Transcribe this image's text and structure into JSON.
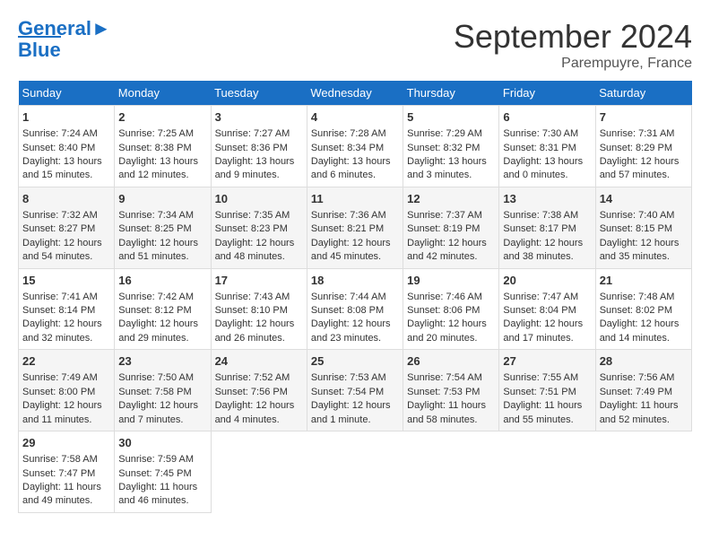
{
  "header": {
    "logo_line1": "General",
    "logo_line2": "Blue",
    "month": "September 2024",
    "location": "Parempuyre, France"
  },
  "days_of_week": [
    "Sunday",
    "Monday",
    "Tuesday",
    "Wednesday",
    "Thursday",
    "Friday",
    "Saturday"
  ],
  "weeks": [
    [
      {
        "day": 1,
        "lines": [
          "Sunrise: 7:24 AM",
          "Sunset: 8:40 PM",
          "Daylight: 13 hours",
          "and 15 minutes."
        ]
      },
      {
        "day": 2,
        "lines": [
          "Sunrise: 7:25 AM",
          "Sunset: 8:38 PM",
          "Daylight: 13 hours",
          "and 12 minutes."
        ]
      },
      {
        "day": 3,
        "lines": [
          "Sunrise: 7:27 AM",
          "Sunset: 8:36 PM",
          "Daylight: 13 hours",
          "and 9 minutes."
        ]
      },
      {
        "day": 4,
        "lines": [
          "Sunrise: 7:28 AM",
          "Sunset: 8:34 PM",
          "Daylight: 13 hours",
          "and 6 minutes."
        ]
      },
      {
        "day": 5,
        "lines": [
          "Sunrise: 7:29 AM",
          "Sunset: 8:32 PM",
          "Daylight: 13 hours",
          "and 3 minutes."
        ]
      },
      {
        "day": 6,
        "lines": [
          "Sunrise: 7:30 AM",
          "Sunset: 8:31 PM",
          "Daylight: 13 hours",
          "and 0 minutes."
        ]
      },
      {
        "day": 7,
        "lines": [
          "Sunrise: 7:31 AM",
          "Sunset: 8:29 PM",
          "Daylight: 12 hours",
          "and 57 minutes."
        ]
      }
    ],
    [
      {
        "day": 8,
        "lines": [
          "Sunrise: 7:32 AM",
          "Sunset: 8:27 PM",
          "Daylight: 12 hours",
          "and 54 minutes."
        ]
      },
      {
        "day": 9,
        "lines": [
          "Sunrise: 7:34 AM",
          "Sunset: 8:25 PM",
          "Daylight: 12 hours",
          "and 51 minutes."
        ]
      },
      {
        "day": 10,
        "lines": [
          "Sunrise: 7:35 AM",
          "Sunset: 8:23 PM",
          "Daylight: 12 hours",
          "and 48 minutes."
        ]
      },
      {
        "day": 11,
        "lines": [
          "Sunrise: 7:36 AM",
          "Sunset: 8:21 PM",
          "Daylight: 12 hours",
          "and 45 minutes."
        ]
      },
      {
        "day": 12,
        "lines": [
          "Sunrise: 7:37 AM",
          "Sunset: 8:19 PM",
          "Daylight: 12 hours",
          "and 42 minutes."
        ]
      },
      {
        "day": 13,
        "lines": [
          "Sunrise: 7:38 AM",
          "Sunset: 8:17 PM",
          "Daylight: 12 hours",
          "and 38 minutes."
        ]
      },
      {
        "day": 14,
        "lines": [
          "Sunrise: 7:40 AM",
          "Sunset: 8:15 PM",
          "Daylight: 12 hours",
          "and 35 minutes."
        ]
      }
    ],
    [
      {
        "day": 15,
        "lines": [
          "Sunrise: 7:41 AM",
          "Sunset: 8:14 PM",
          "Daylight: 12 hours",
          "and 32 minutes."
        ]
      },
      {
        "day": 16,
        "lines": [
          "Sunrise: 7:42 AM",
          "Sunset: 8:12 PM",
          "Daylight: 12 hours",
          "and 29 minutes."
        ]
      },
      {
        "day": 17,
        "lines": [
          "Sunrise: 7:43 AM",
          "Sunset: 8:10 PM",
          "Daylight: 12 hours",
          "and 26 minutes."
        ]
      },
      {
        "day": 18,
        "lines": [
          "Sunrise: 7:44 AM",
          "Sunset: 8:08 PM",
          "Daylight: 12 hours",
          "and 23 minutes."
        ]
      },
      {
        "day": 19,
        "lines": [
          "Sunrise: 7:46 AM",
          "Sunset: 8:06 PM",
          "Daylight: 12 hours",
          "and 20 minutes."
        ]
      },
      {
        "day": 20,
        "lines": [
          "Sunrise: 7:47 AM",
          "Sunset: 8:04 PM",
          "Daylight: 12 hours",
          "and 17 minutes."
        ]
      },
      {
        "day": 21,
        "lines": [
          "Sunrise: 7:48 AM",
          "Sunset: 8:02 PM",
          "Daylight: 12 hours",
          "and 14 minutes."
        ]
      }
    ],
    [
      {
        "day": 22,
        "lines": [
          "Sunrise: 7:49 AM",
          "Sunset: 8:00 PM",
          "Daylight: 12 hours",
          "and 11 minutes."
        ]
      },
      {
        "day": 23,
        "lines": [
          "Sunrise: 7:50 AM",
          "Sunset: 7:58 PM",
          "Daylight: 12 hours",
          "and 7 minutes."
        ]
      },
      {
        "day": 24,
        "lines": [
          "Sunrise: 7:52 AM",
          "Sunset: 7:56 PM",
          "Daylight: 12 hours",
          "and 4 minutes."
        ]
      },
      {
        "day": 25,
        "lines": [
          "Sunrise: 7:53 AM",
          "Sunset: 7:54 PM",
          "Daylight: 12 hours",
          "and 1 minute."
        ]
      },
      {
        "day": 26,
        "lines": [
          "Sunrise: 7:54 AM",
          "Sunset: 7:53 PM",
          "Daylight: 11 hours",
          "and 58 minutes."
        ]
      },
      {
        "day": 27,
        "lines": [
          "Sunrise: 7:55 AM",
          "Sunset: 7:51 PM",
          "Daylight: 11 hours",
          "and 55 minutes."
        ]
      },
      {
        "day": 28,
        "lines": [
          "Sunrise: 7:56 AM",
          "Sunset: 7:49 PM",
          "Daylight: 11 hours",
          "and 52 minutes."
        ]
      }
    ],
    [
      {
        "day": 29,
        "lines": [
          "Sunrise: 7:58 AM",
          "Sunset: 7:47 PM",
          "Daylight: 11 hours",
          "and 49 minutes."
        ]
      },
      {
        "day": 30,
        "lines": [
          "Sunrise: 7:59 AM",
          "Sunset: 7:45 PM",
          "Daylight: 11 hours",
          "and 46 minutes."
        ]
      },
      null,
      null,
      null,
      null,
      null
    ]
  ]
}
